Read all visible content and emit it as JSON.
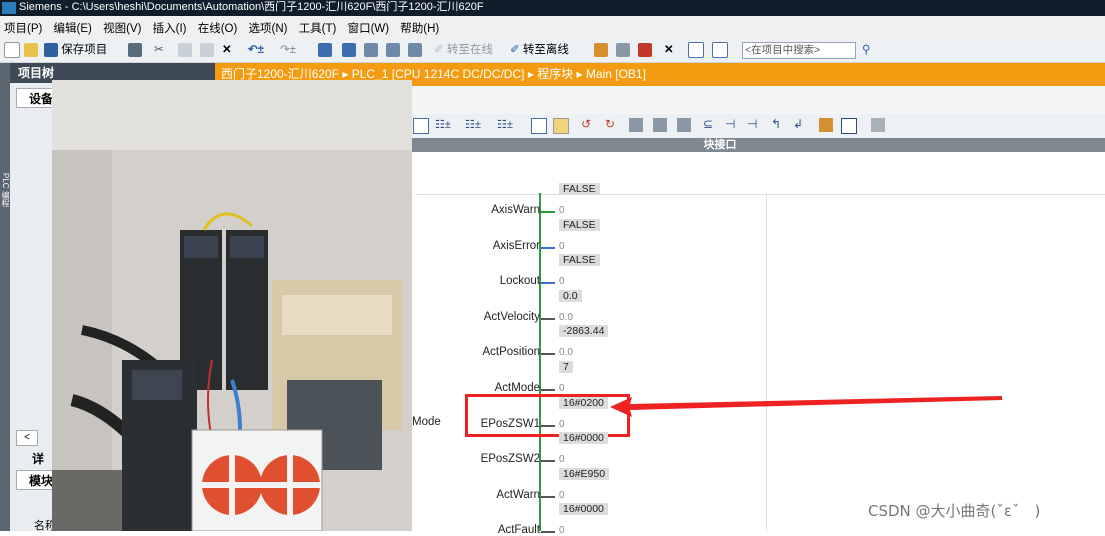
{
  "window": {
    "title": "Siemens  -  C:\\Users\\heshi\\Documents\\Automation\\西门子1200-汇川620F\\西门子1200-汇川620F"
  },
  "menu": [
    "项目(P)",
    "编辑(E)",
    "视图(V)",
    "插入(I)",
    "在线(O)",
    "选项(N)",
    "工具(T)",
    "窗口(W)",
    "帮助(H)"
  ],
  "toolbar": {
    "save_label": "保存项目",
    "go_online_label": "转至在线",
    "go_offline_label": "转至离线",
    "search_placeholder": "<在项目中搜索>"
  },
  "project_tree": {
    "title": "项目树",
    "tab_devices": "设备",
    "side_label": "PLC 编程",
    "details_title": "详",
    "details_tab": "模块",
    "name_col": "名称"
  },
  "breadcrumb": [
    "西门子1200-汇川620F",
    "PLC_1 [CPU 1214C DC/DC/DC]",
    "程序块",
    "Main [OB1]"
  ],
  "editor": {
    "block_interface_label": "块接口",
    "mode_pin_label": "Mode"
  },
  "ladder_pins": [
    {
      "name": "AxisWarn",
      "value": "FALSE",
      "wire": "true"
    },
    {
      "name": "AxisError",
      "value": "FALSE",
      "wire": "false"
    },
    {
      "name": "Lockout",
      "value": "FALSE",
      "wire": "false"
    },
    {
      "name": "ActVelocity",
      "value": "0.0",
      "wire": "real"
    },
    {
      "name": "ActPosition",
      "value": "-2863.44",
      "wire": "real"
    },
    {
      "name": "ActMode",
      "value": "7",
      "wire": "int"
    },
    {
      "name": "EPosZSW1",
      "value": "16#0200",
      "wire": "int"
    },
    {
      "name": "EPosZSW2",
      "value": "16#0000",
      "wire": "int"
    },
    {
      "name": "ActWarn",
      "value": "16#E950",
      "wire": "int"
    },
    {
      "name": "ActFault",
      "value": "16#0000",
      "wire": "int"
    }
  ],
  "zero_text": "0",
  "real_zero_text": "0.0",
  "watermark": "CSDN @大小曲奇(ˇεˇ　)",
  "colors": {
    "accent_orange": "#f39c12",
    "highlight_red": "#ee2222",
    "rail_green": "#2c9a3d"
  }
}
